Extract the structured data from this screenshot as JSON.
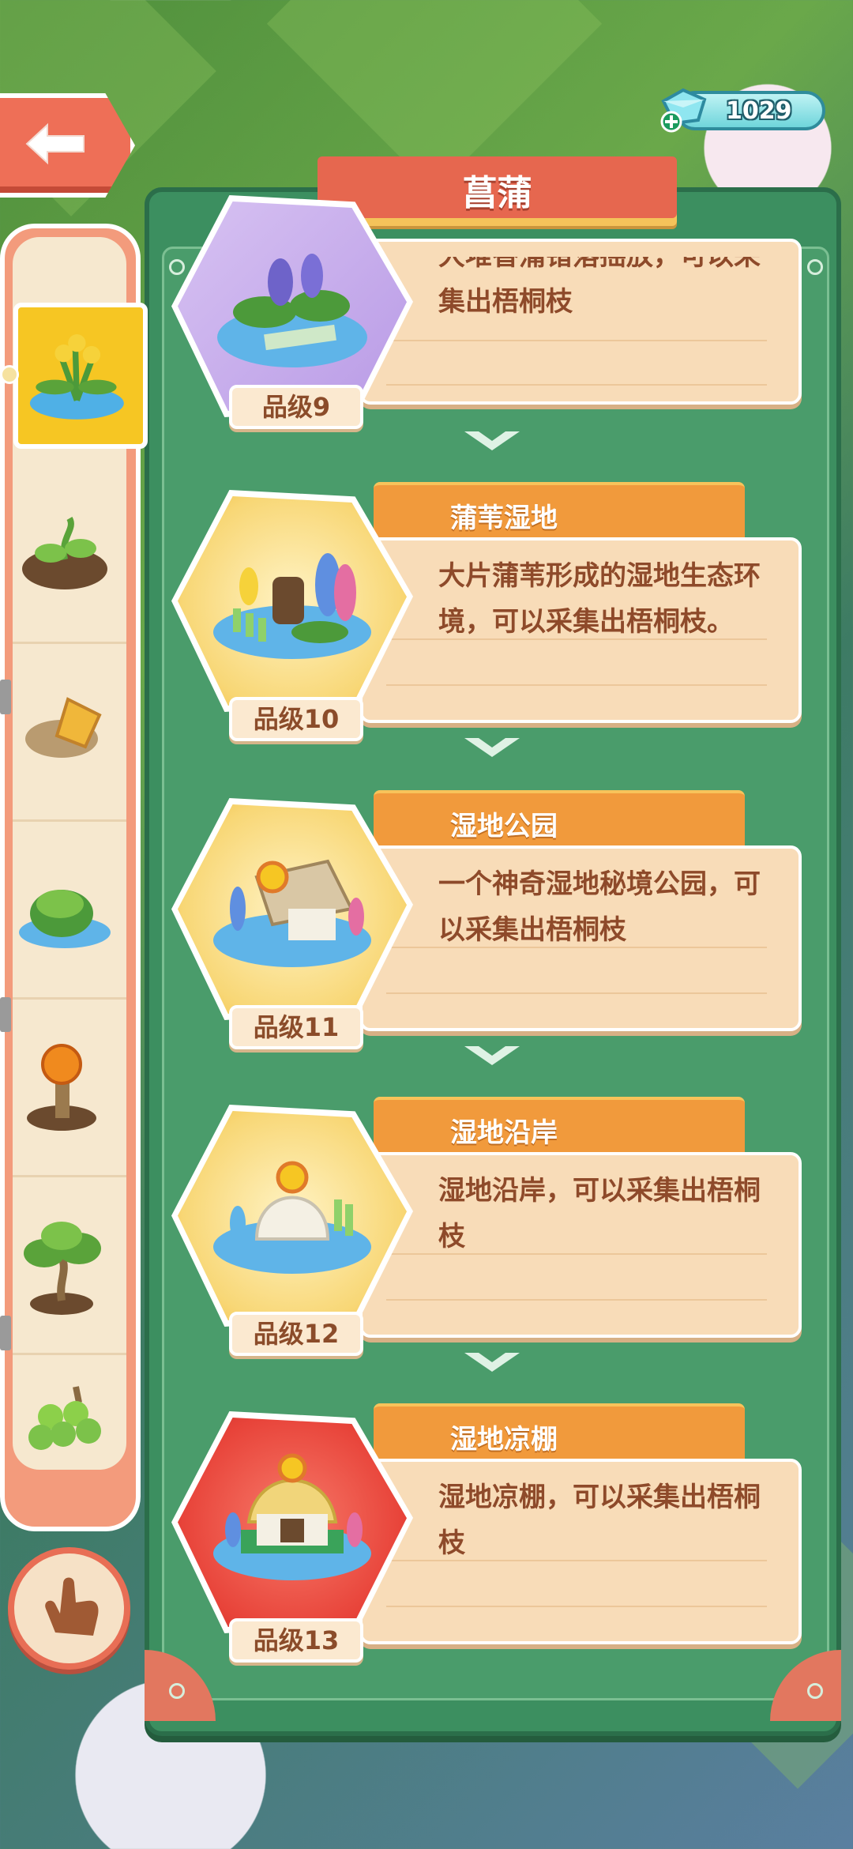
{
  "header": {
    "title": "菖蒲",
    "gems": "1029"
  },
  "sidebar": {
    "items": [
      {
        "icon": "reed-plant-icon",
        "active": true
      },
      {
        "icon": "sprout-icon",
        "active": false
      },
      {
        "icon": "leaf-rock-icon",
        "active": false
      },
      {
        "icon": "grass-pond-icon",
        "active": false
      },
      {
        "icon": "fruit-stump-icon",
        "active": false
      },
      {
        "icon": "bonsai-tree-icon",
        "active": false
      },
      {
        "icon": "grapes-icon",
        "active": false
      }
    ]
  },
  "entries": [
    {
      "name": "",
      "desc": "大堆香蒲错落摇放，可以采集出梧桐枝",
      "grade": "品级9"
    },
    {
      "name": "蒲苇湿地",
      "desc": "大片蒲苇形成的湿地生态环境，可以采集出梧桐枝。",
      "grade": "品级10"
    },
    {
      "name": "湿地公园",
      "desc": "一个神奇湿地秘境公园，可以采集出梧桐枝",
      "grade": "品级11"
    },
    {
      "name": "湿地沿岸",
      "desc": "湿地沿岸，可以采集出梧桐枝",
      "grade": "品级12"
    },
    {
      "name": "湿地凉棚",
      "desc": "湿地凉棚，可以采集出梧桐枝",
      "grade": "品级13"
    }
  ],
  "colors": {
    "panel": "#3c8f60",
    "ribbon": "#e6674f",
    "tab": "#f19a3c",
    "card": "#f8dcb8",
    "text": "#8e4a2a",
    "active": "#f6c623"
  }
}
